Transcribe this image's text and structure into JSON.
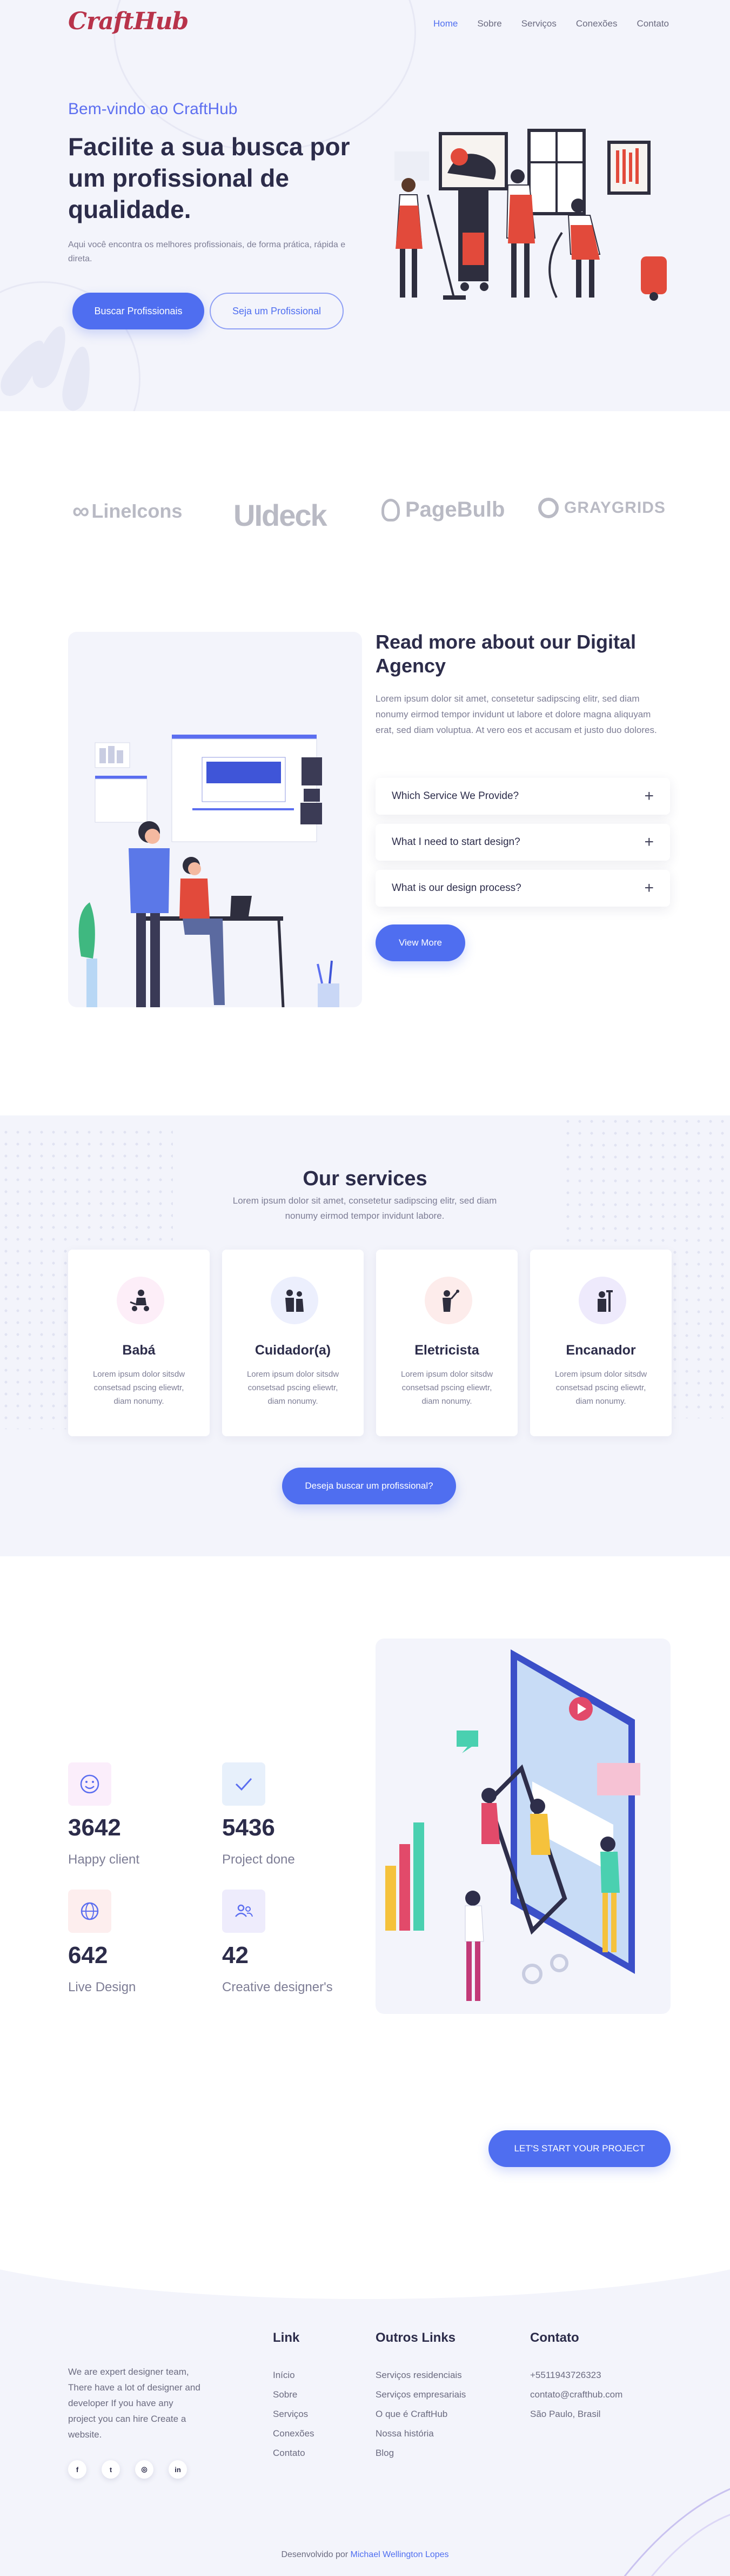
{
  "nav": {
    "logo": "CraftHub",
    "items": [
      {
        "label": "Home",
        "active": true
      },
      {
        "label": "Sobre",
        "active": false
      },
      {
        "label": "Serviços",
        "active": false
      },
      {
        "label": "Conexões",
        "active": false
      },
      {
        "label": "Contato",
        "active": false
      }
    ]
  },
  "hero": {
    "welcome": "Bem-vindo ao CraftHub",
    "title": "Facilite a sua busca por um profissional de qualidade.",
    "description": "Aqui você encontra os melhores profissionais, de forma prática, rápida e direta.",
    "primary_button": "Buscar Profissionais",
    "secondary_button": "Seja um Profissional"
  },
  "brands": [
    "LineIcons",
    "UIdeck",
    "PageBulb",
    "GRAYGRIDS"
  ],
  "about": {
    "title": "Read more about our Digital Agency",
    "text": "Lorem ipsum dolor sit amet, consetetur sadipscing elitr, sed diam nonumy eirmod tempor invidunt ut labore et dolore magna aliquyam erat, sed diam voluptua. At vero eos et accusam et justo duo dolores.",
    "accordion": [
      "Which Service We Provide?",
      "What I need to start design?",
      "What is our design process?"
    ],
    "button": "View More"
  },
  "services": {
    "title": "Our services",
    "subtitle": "Lorem ipsum dolor sit amet, consetetur sadipscing elitr, sed diam nonumy eirmod tempor invidunt labore.",
    "cards": [
      {
        "name": "Babá",
        "desc": "Lorem ipsum dolor sitsdw consetsad pscing eliewtr, diam nonumy.",
        "icon": "babysitter-icon",
        "icon_bg": "#fdeef8"
      },
      {
        "name": "Cuidador(a)",
        "desc": "Lorem ipsum dolor sitsdw consetsad pscing eliewtr, diam nonumy.",
        "icon": "caregiver-icon",
        "icon_bg": "#eceffd"
      },
      {
        "name": "Eletricista",
        "desc": "Lorem ipsum dolor sitsdw consetsad pscing eliewtr, diam nonumy.",
        "icon": "electrician-icon",
        "icon_bg": "#fdeceb"
      },
      {
        "name": "Encanador",
        "desc": "Lorem ipsum dolor sitsdw consetsad pscing eliewtr, diam nonumy.",
        "icon": "plumber-icon",
        "icon_bg": "#eeeafc"
      }
    ],
    "button": "Deseja buscar um profissional?"
  },
  "stats": [
    {
      "value": "3642",
      "label": "Happy client",
      "icon": "smile-icon",
      "icon_bg": "#fbeefb"
    },
    {
      "value": "5436",
      "label": "Project done",
      "icon": "check-icon",
      "icon_bg": "#e7f0fb"
    },
    {
      "value": "642",
      "label": "Live Design",
      "icon": "globe-icon",
      "icon_bg": "#fdeeee"
    },
    {
      "value": "42",
      "label": "Creative designer's",
      "icon": "users-icon",
      "icon_bg": "#eeecfc"
    }
  ],
  "cta": {
    "button": "LET'S START YOUR PROJECT"
  },
  "footer": {
    "about": "We are expert designer team, There have a lot of designer and developer If you have any project you can hire Create a website.",
    "social": [
      "facebook-icon",
      "twitter-icon",
      "instagram-icon",
      "linkedin-icon"
    ],
    "columns": [
      {
        "title": "Link",
        "items": [
          "Início",
          "Sobre",
          "Serviços",
          "Conexões",
          "Contato"
        ]
      },
      {
        "title": "Outros Links",
        "items": [
          "Serviços residenciais",
          "Serviços empresariais",
          "O que é CraftHub",
          "Nossa história",
          "Blog"
        ]
      },
      {
        "title": "Contato",
        "items": [
          "+5511943726323",
          "contato@crafthub.com",
          "São Paulo, Brasil"
        ]
      }
    ],
    "credit_prefix": "Desenvolvido por",
    "credit_author": "Michael Wellington Lopes"
  },
  "colors": {
    "accent": "#4f6ef0",
    "logo": "#b8334a",
    "soft_bg": "#f3f4fb"
  }
}
